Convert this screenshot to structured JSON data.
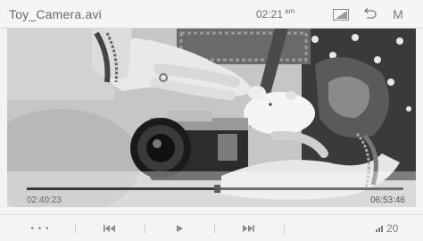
{
  "header": {
    "title": "Toy_Camera.avi",
    "time": "02:21",
    "ampm": "am",
    "menu_label": "M"
  },
  "icons": {
    "screen": "screen-mode-icon",
    "back": "back-arrow-icon",
    "more": "more-dots-icon",
    "prev": "previous-track-icon",
    "play": "play-icon",
    "next": "next-track-icon",
    "volume": "volume-bars-icon"
  },
  "playback": {
    "elapsed": "02:40:23",
    "total": "06:53:46",
    "progress": 0.505
  },
  "controls": {
    "more_label": "• • •",
    "volume": "20"
  },
  "colors": {
    "background": "#f3f3f3",
    "progress_track": "#6e6e6e",
    "text": "#666666"
  }
}
